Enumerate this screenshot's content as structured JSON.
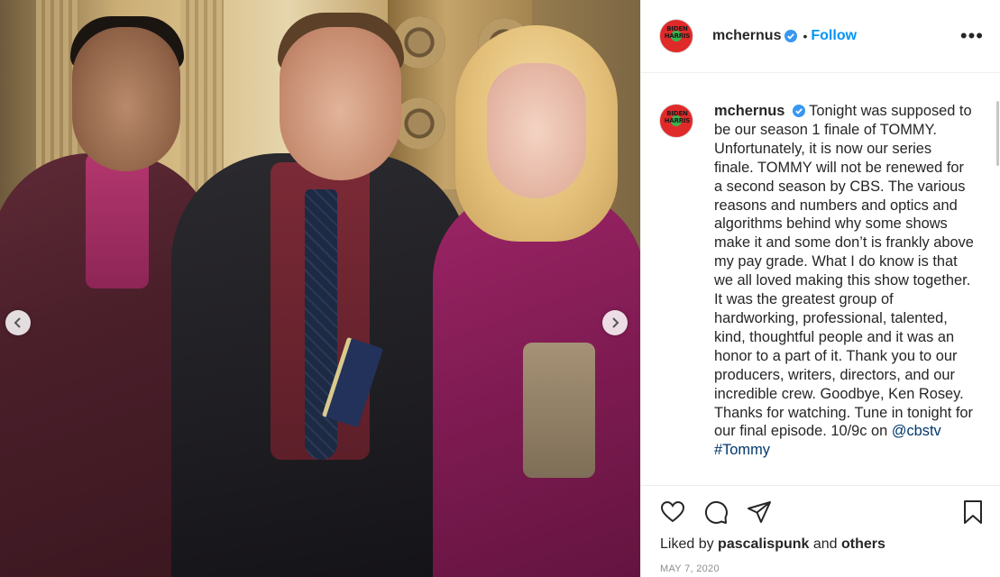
{
  "post": {
    "username": "mchernus",
    "follow_label": "Follow",
    "separator": "•",
    "more_label": "•••",
    "avatar_text": "BIDEN HARRIS",
    "caption": {
      "username": "mchernus",
      "text": "Tonight was supposed to be our season 1 finale of TOMMY. Unfortunately, it is now our series finale. TOMMY will not be renewed for a second season by CBS. The various reasons and numbers and optics and algorithms behind why some shows make it and some don’t is frankly above my pay grade. What I do know is that we all loved making this show together. It was the greatest group of hardworking, professional, talented, kind, thoughtful people and it was an honor to a part of it. Thank you to our producers, writers, directors, and our incredible crew. Goodbye, Ken Rosey. Thanks for watching. Tune in tonight for our final episode. 10/9c on",
      "mention": "@cbstv",
      "hashtag": "#Tommy"
    },
    "likes": {
      "prefix": "Liked by",
      "user": "pascalispunk",
      "middle": "and",
      "others": "others"
    },
    "date": "MAY 7, 2020"
  },
  "icons": {
    "prev": "chevron-left-icon",
    "next": "chevron-right-icon",
    "like": "heart-icon",
    "comment": "comment-icon",
    "share": "share-icon",
    "save": "bookmark-icon",
    "verified": "verified-badge-icon"
  },
  "colors": {
    "accent": "#0095f6",
    "verified": "#3897f0",
    "text": "#262626",
    "muted": "#8e8e8e",
    "link": "#00376b"
  }
}
